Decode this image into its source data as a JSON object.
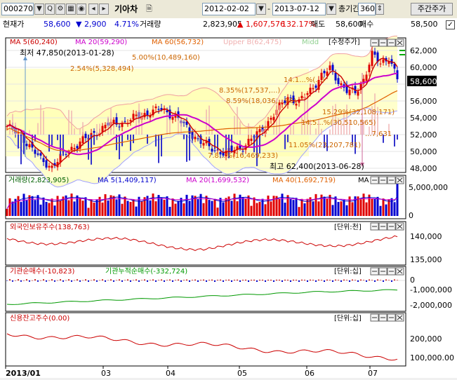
{
  "toolbar": {
    "code": "000270",
    "name": "기아차",
    "date_from": "2012-02-02",
    "date_to": "2013-07-12",
    "period_label": "총기간",
    "period_value": "360",
    "weekly_button": "주간주가",
    "separator": "-"
  },
  "quote": {
    "price_label": "현재가",
    "price": "58,600",
    "change": "▼ 2,900",
    "change_pct": "4.71%",
    "volume_label": "거래량",
    "volume": "2,823,905",
    "volume_change": "▲ 1,607,576",
    "volume_pct": "132.17%",
    "ask_label": "매도",
    "ask": "58,600",
    "bid_label": "매수",
    "bid": "58,500"
  },
  "price_panel": {
    "legend": [
      {
        "text": "MA 5(60,240)",
        "color": "#cc0000"
      },
      {
        "text": "MA 20(59,290)",
        "color": "#cc00cc"
      },
      {
        "text": "MA 60(56,732)",
        "color": "#e06000"
      },
      {
        "text": "Upper B(62,475)",
        "color": "#f0b0b0"
      },
      {
        "text": "Midd",
        "color": "#90d090"
      }
    ],
    "adjusted_label": "수정주가",
    "y_ticks": [
      "62,000",
      "60,000",
      "58,000",
      "56,000",
      "54,000",
      "52,000",
      "50,000",
      "48,000"
    ],
    "current_price_tag": "58,600",
    "annotations": {
      "low": "최저 47,850(2013-01-28)",
      "high": "최고 62,400(2013-06-28)",
      "fib_500": "5.00%(10,489,160)",
      "fib_254": "2.54%(5,328,494)",
      "fib_835": "8.35%(17,537,...)",
      "fib_859": "8.59%(18,036,...96)",
      "fib_1418": "14.1...%(...)",
      "fib_1529": "15.29%(32,108,171)",
      "fib_1455": "14.5...%(30,510,565)",
      "fib_1105": "11.05%(23,207,781)",
      "fib_784": "7.8...%(16,469,233)",
      "fib_r": "...7,631"
    }
  },
  "volume_panel": {
    "legend": [
      {
        "text": "거래량(2,823,905)",
        "color": "#006000"
      },
      {
        "text": "MA 5(1,409,117)",
        "color": "#0000cc"
      },
      {
        "text": "MA 20(1,699,532)",
        "color": "#cc00cc"
      },
      {
        "text": "MA 40(1,692,719)",
        "color": "#e06000"
      },
      {
        "text": "MA",
        "color": "#000000"
      }
    ],
    "y_ticks": [
      "5,000,000",
      "0"
    ]
  },
  "foreign_panel": {
    "legend": "외국인보유주수(138,763)",
    "unit": "[단위:천]",
    "y_ticks": [
      "140,000",
      "135,000"
    ]
  },
  "institution_panel": {
    "legend1": "기관순매수(-10,823)",
    "legend2": "기관누적순매수(-332,724)",
    "unit": "[단위:십]",
    "y_ticks": [
      "0",
      "-1,000,000",
      "-2,000,000"
    ]
  },
  "credit_panel": {
    "legend": "신용잔고주수(0.00)",
    "unit": "[단위:십]",
    "y_ticks": [
      "200,000",
      "100,000.00"
    ]
  },
  "x_axis": [
    "2013/01",
    "03",
    "04",
    "05",
    "06",
    "07"
  ],
  "colors": {
    "up": "#e00000",
    "down": "#0000d0",
    "band_fill": "#ffffcc",
    "ma5": "#cc0000",
    "ma20": "#cc00cc",
    "ma60": "#e06000"
  }
}
